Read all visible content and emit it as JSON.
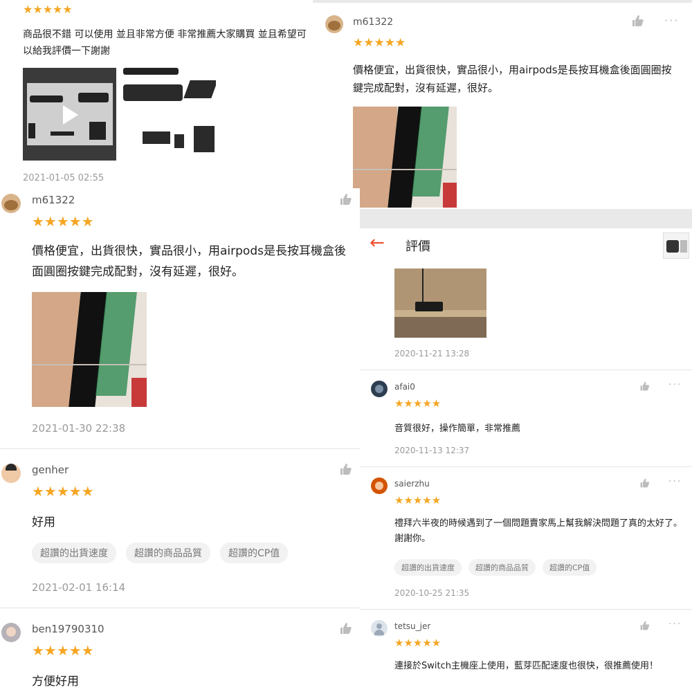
{
  "tl_panel": {
    "review_text": "商品很不錯 可以使用 並且非常方便 非常推薦大家購買 並且希望可以給我評價一下謝謝",
    "date": "2021-01-05 02:55",
    "stars": "★★★★★"
  },
  "tr_panel": {
    "username": "m61322",
    "review_text": "價格便宜，出貨很快，實品很小，用airpods是長按耳機盒後面圓圈按鍵完成配對，沒有延遲，很好。",
    "stars": "★★★★★",
    "more": "···"
  },
  "left_panel": {
    "reviews": [
      {
        "username": "m61322",
        "stars": "★★★★★",
        "text": "價格便宜，出貨很快，實品很小，用airpods是長按耳機盒後面圓圈按鍵完成配對，沒有延遲，很好。",
        "date": "2021-01-30 22:38"
      },
      {
        "username": "genher",
        "stars": "★★★★★",
        "text": "好用",
        "tags": [
          "超讚的出貨速度",
          "超讚的商品品質",
          "超讚的CP值"
        ],
        "date": "2021-02-01 16:14"
      },
      {
        "username": "ben19790310",
        "stars": "★★★★★",
        "text": "方便好用"
      }
    ]
  },
  "right_panel": {
    "header_title": "評價",
    "back_arrow": "←",
    "first_date": "2020-11-21 13:28",
    "reviews": [
      {
        "username": "afai0",
        "stars": "★★★★★",
        "text": "音質很好，操作簡單，非常推薦",
        "date": "2020-11-13 12:37",
        "more": "···"
      },
      {
        "username": "saierzhu",
        "stars": "★★★★★",
        "text": "禮拜六半夜的時候遇到了一個問題賣家馬上幫我解決問題了真的太好了。謝謝你。",
        "tags": [
          "超讚的出貨速度",
          "超讚的商品品質",
          "超讚的CP值"
        ],
        "date": "2020-10-25 21:35",
        "more": "···"
      },
      {
        "username": "tetsu_jer",
        "stars": "★★★★★",
        "text": "連接於Switch主機座上使用，藍芽匹配速度也很快，很推薦使用！",
        "more": "···"
      }
    ]
  },
  "colors": {
    "star": "#f5a623",
    "accent": "#ee4d2d"
  },
  "icons": {
    "like": "thumbs-up-icon",
    "more": "more-icon",
    "back": "back-arrow-icon",
    "play": "play-icon"
  }
}
